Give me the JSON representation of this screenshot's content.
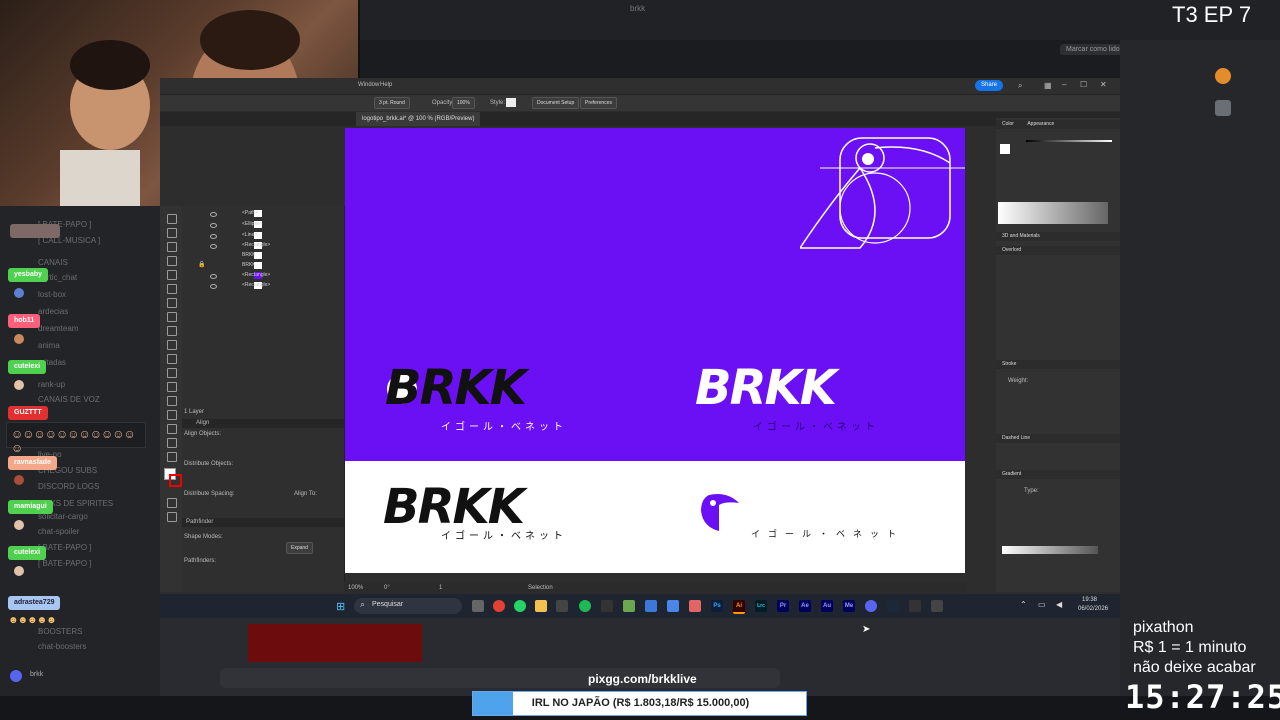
{
  "stream": {
    "episode": "T3 EP 7",
    "pixathon_lines": [
      "pixathon",
      "R$ 1 = 1 minuto",
      "não deixe acabar"
    ],
    "timer": "15:27:25",
    "pix_url": "pixgg.com/brkklive",
    "goal_text": "IRL NO JAPÃO (R$ 1.803,18/R$ 15.000,00)",
    "goal_progress": 0.12
  },
  "discord": {
    "channels": [
      "[ BATE-PAPO ]",
      "[ CALL-MUSICA ]",
      "CANAIS",
      "gartic_chat",
      "lost-box",
      "ardecias",
      "dreamteam",
      "anima",
      "mitadas",
      "rank-up",
      "CANAIS DE VOZ",
      "live-no",
      "CHEGOU SUBS",
      "DISCORD LOGS",
      "LINKS DE SPIRITES",
      "solicitar-cargo",
      "chat-spoiler",
      "[ BATE-PAPO ]",
      "[ BATE-PAPO ]",
      "BOOSTERS",
      "chat-boosters"
    ],
    "user_pills": [
      "yesbaby",
      "hob11",
      "cutelexi",
      "GUZTTT",
      "ravnasfade",
      "mamiagui",
      "cutelexi",
      "adrastea729"
    ],
    "pill_colors": [
      "#4fd14f",
      "#ff5f7a",
      "#4fd14f",
      "#e23030",
      "#f5a78a",
      "#4fd14f",
      "#4fd14f",
      "#a8c6f2"
    ],
    "user_footer": "brkk",
    "right_top_button": "Marcar como lido"
  },
  "window": {
    "title": "brkk",
    "menu_items": [
      "Window",
      "Help"
    ]
  },
  "illustrator": {
    "control": {
      "stroke": "3 pt. Round",
      "opacity_label": "Opacity:",
      "opacity_value": "100%",
      "style_label": "Style:",
      "doc_setup": "Document Setup",
      "prefs": "Preferences"
    },
    "doc_tab": "logotipo_brkk.ai* @ 100 % (RGB/Preview)",
    "share_button": "Share",
    "layers": [
      "<Path>",
      "<Ellipse>",
      "<Line>",
      "<Rectangle>",
      "BRKK",
      "BRKK",
      "<Rectangle>",
      "<Rectangle>"
    ],
    "layers_footer": "1 Layer",
    "align_panel": {
      "title": "Align",
      "align_objects": "Align Objects:",
      "distribute_objects": "Distribute Objects:",
      "distribute_spacing": "Distribute Spacing:",
      "align_to": "Align To:",
      "pathfinder": "Pathfinder",
      "shape_modes": "Shape Modes:",
      "pathfinders": "Pathfinders:",
      "expand": "Expand"
    },
    "right_panels": {
      "color_tab": "Color",
      "appearance_tab": "Appearance",
      "three_d": "3D and Materials",
      "overlord": "Overlord",
      "stroke": "Stroke",
      "weight": "Weight:",
      "dashed_line": "Dashed Line",
      "gradient": "Gradient",
      "type_label": "Type:"
    },
    "status": {
      "zoom": "100%",
      "rotation": "0°",
      "artboard": "1",
      "tool": "Selection"
    },
    "artwork": {
      "logo_text": "BRKK",
      "kana": "イゴール・ベネット",
      "purple": "#6b10f5"
    }
  },
  "taskbar": {
    "search": "Pesquisar",
    "time": "19:38",
    "date": "06/02/2026",
    "apps": [
      "Ps",
      "Ai",
      "Lrc",
      "Pr",
      "Ae",
      "Au",
      "Me"
    ]
  }
}
